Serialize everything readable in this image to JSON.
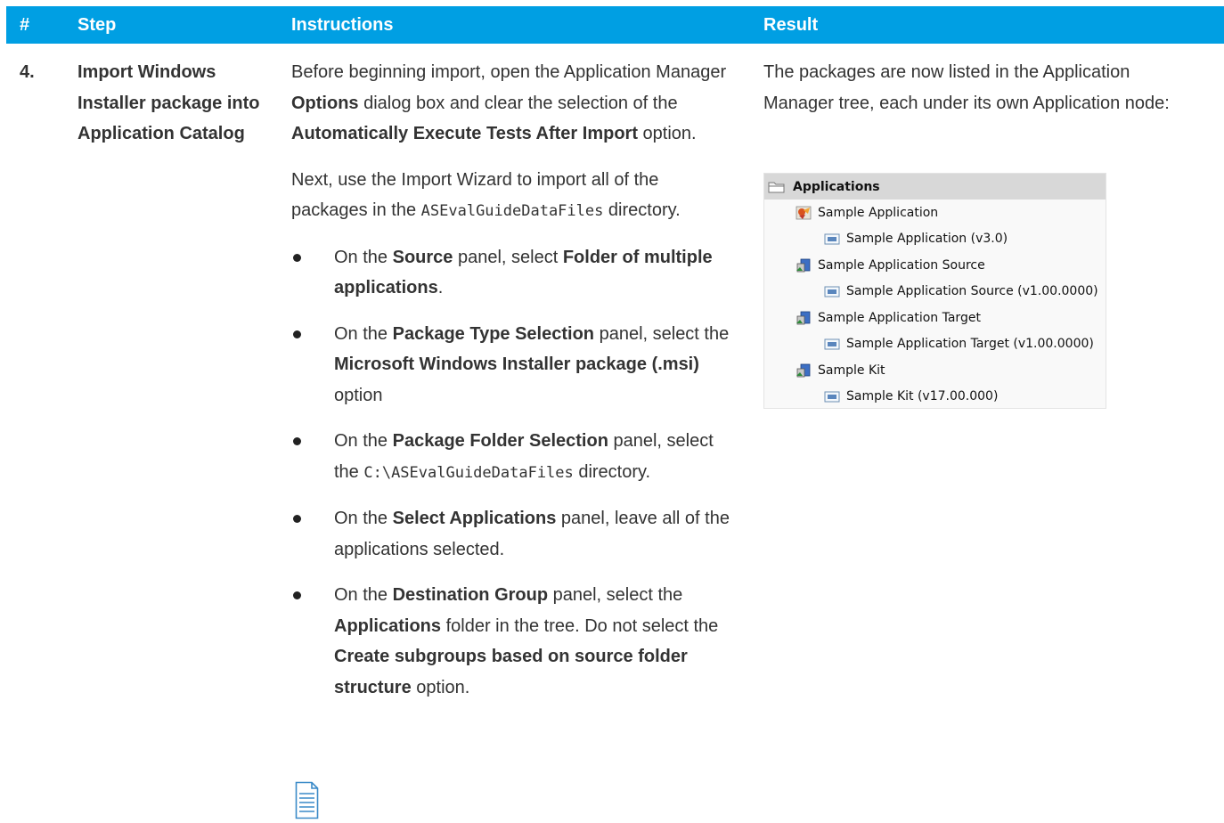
{
  "header": {
    "num": "#",
    "step": "Step",
    "instructions": "Instructions",
    "result": "Result"
  },
  "row": {
    "num": "4.",
    "step": "Import Windows Installer package into Application Catalog",
    "instr_p1": {
      "a": "Before beginning import, open the Application Manager ",
      "b1": "Options",
      "c": " dialog box and clear the selection of the ",
      "b2": "Automatically Execute Tests After Import",
      "d": " option."
    },
    "instr_p2": {
      "a": "Next, use the Import Wizard to import all of the packages in the ",
      "code": "ASEvalGuideDataFiles",
      "b": " directory."
    },
    "bullets": [
      {
        "a": "On the ",
        "b1": "Source",
        "c": " panel, select ",
        "b2": "Folder of multiple applications",
        "d": "."
      },
      {
        "a": "On the ",
        "b1": "Package Type Selection",
        "c": " panel, select the ",
        "b2": "Microsoft Windows Installer package (.msi)",
        "d": " option"
      },
      {
        "a": "On the ",
        "b1": "Package Folder Selection",
        "c": " panel, select the ",
        "code": "C:\\ASEvalGuideDataFiles",
        "d": " directory."
      },
      {
        "a": "On the ",
        "b1": "Select Applications",
        "c": " panel, leave all of the applications selected."
      },
      {
        "a": "On the ",
        "b1": "Destination Group",
        "c": " panel, select the ",
        "b2": "Applications",
        "d": " folder in the tree. Do not select the ",
        "b3": "Create subgroups based on source folder structure",
        "e": " option."
      }
    ],
    "note_icon": "note-document-icon",
    "result_text": "The packages are now listed in the Application Manager tree, each under its own Application node:",
    "tree": {
      "root": "Applications",
      "items": [
        {
          "label": "Sample Application",
          "icon": "application-icon",
          "child": "Sample Application (v3.0)"
        },
        {
          "label": "Sample Application Source",
          "icon": "installer-icon",
          "child": "Sample Application Source (v1.00.0000)"
        },
        {
          "label": "Sample Application Target",
          "icon": "installer-icon",
          "child": "Sample Application Target (v1.00.0000)"
        },
        {
          "label": "Sample Kit",
          "icon": "installer-icon",
          "child": "Sample Kit (v17.00.000)"
        }
      ]
    }
  },
  "colors": {
    "header_bg": "#009fe3",
    "header_text": "#ffffff",
    "text": "#333333"
  }
}
